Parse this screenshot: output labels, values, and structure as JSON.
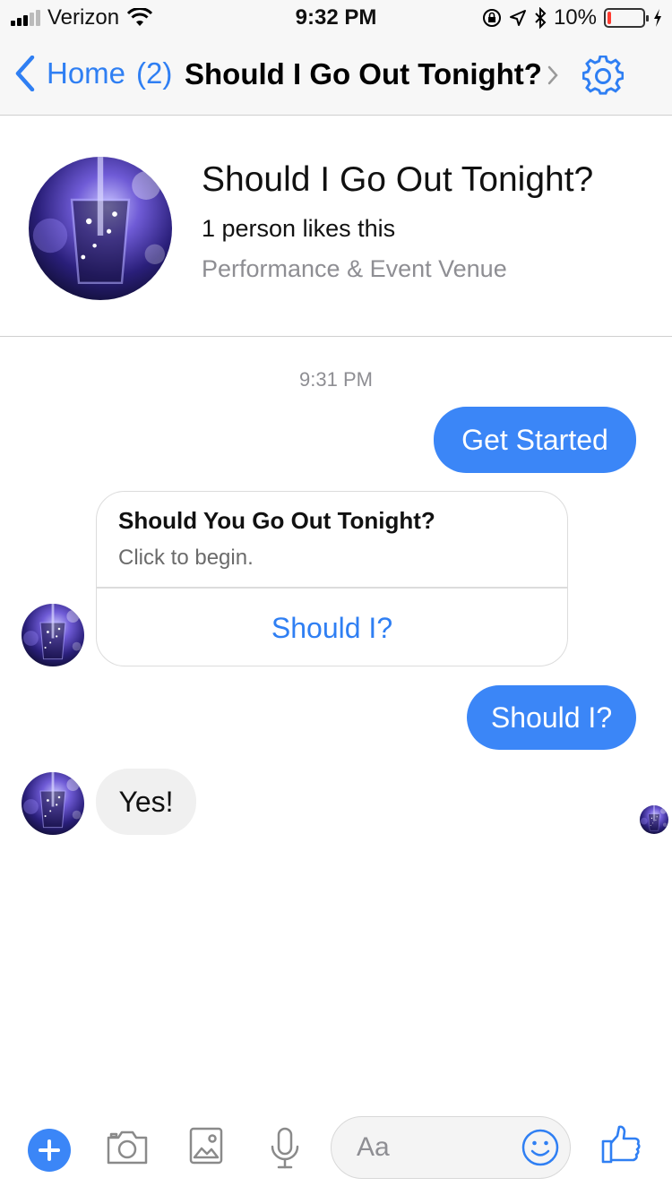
{
  "status_bar": {
    "carrier": "Verizon",
    "time": "9:32 PM",
    "battery": "10%",
    "battery_level": 0.1
  },
  "nav": {
    "back_label": "Home",
    "unread_count": "(2)",
    "title": "Should I Go Out Tonight?"
  },
  "profile": {
    "name": "Should I Go Out Tonight?",
    "likes": "1 person likes this",
    "category": "Performance & Event Venue"
  },
  "conversation": {
    "timestamp": "9:31 PM",
    "messages": [
      {
        "from": "me",
        "text": "Get Started"
      },
      {
        "from": "page",
        "type": "card",
        "title": "Should You Go Out Tonight?",
        "subtitle": "Click to begin.",
        "button": "Should I?"
      },
      {
        "from": "me",
        "text": "Should I?"
      },
      {
        "from": "page",
        "text": "Yes!"
      }
    ]
  },
  "composer": {
    "placeholder": "Aa"
  },
  "colors": {
    "accent": "#3b86f7",
    "link": "#2f7ff3",
    "incoming_bubble": "#f0f0f0"
  },
  "icons": [
    "back-chevron-icon",
    "gear-icon",
    "plus-icon",
    "camera-icon",
    "photo-icon",
    "microphone-icon",
    "emoji-icon",
    "thumbs-up-icon"
  ]
}
